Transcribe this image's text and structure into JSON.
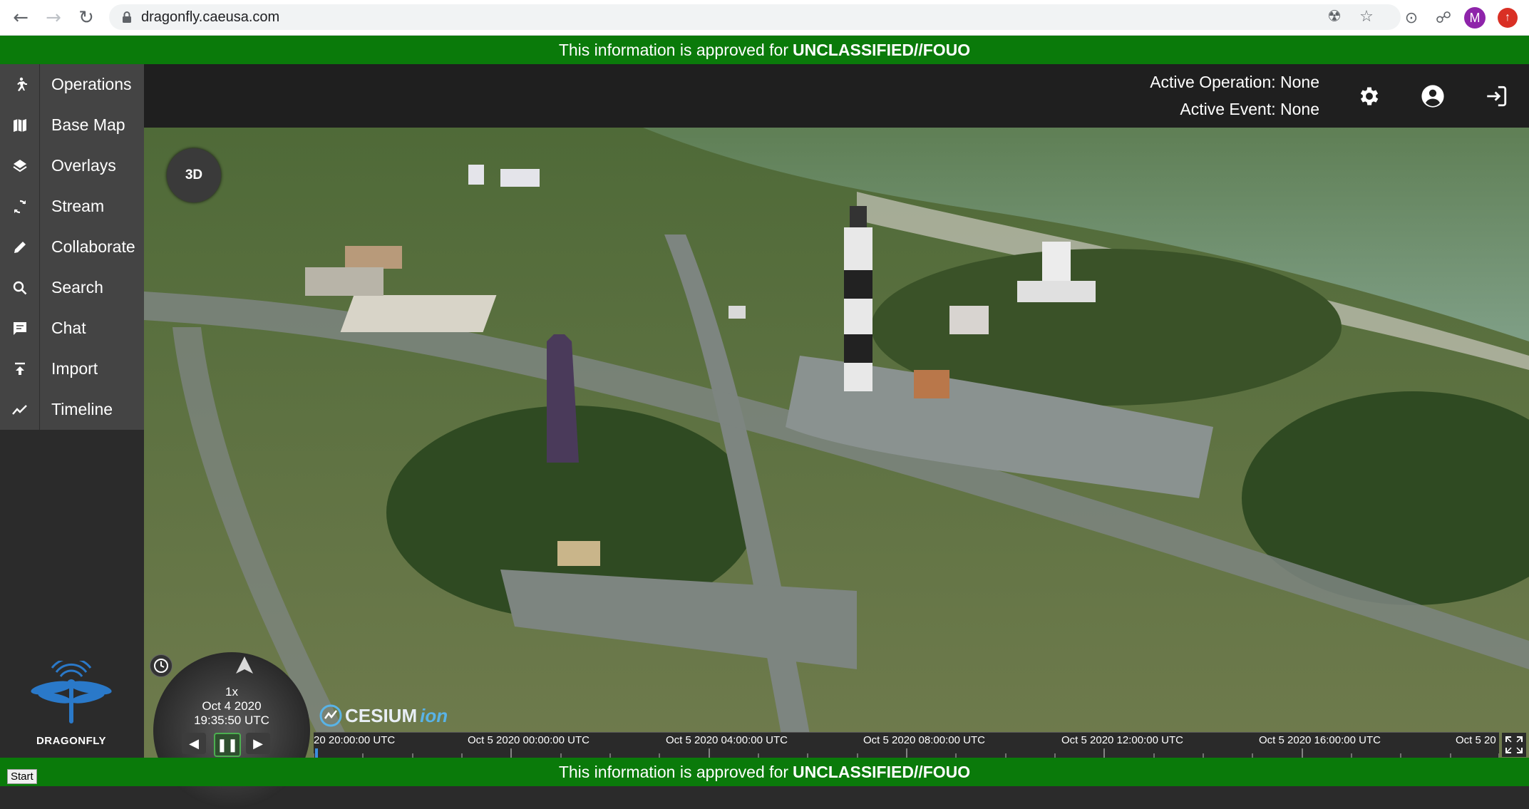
{
  "browser": {
    "url": "dragonfly.caeusa.com",
    "avatar_letter": "M"
  },
  "banner": {
    "prefix": "This information is approved for",
    "classification": "UNCLASSIFIED//FOUO"
  },
  "header": {
    "active_operation": "Active Operation: None",
    "active_event": "Active Event: None"
  },
  "sidebar": {
    "items": [
      {
        "label": "Operations",
        "icon": "running-person-icon"
      },
      {
        "label": "Base Map",
        "icon": "map-icon"
      },
      {
        "label": "Overlays",
        "icon": "layers-icon"
      },
      {
        "label": "Stream",
        "icon": "sync-icon"
      },
      {
        "label": "Collaborate",
        "icon": "pencil-icon"
      },
      {
        "label": "Search",
        "icon": "search-icon"
      },
      {
        "label": "Chat",
        "icon": "chat-icon"
      },
      {
        "label": "Import",
        "icon": "upload-icon"
      },
      {
        "label": "Timeline",
        "icon": "trend-line-icon"
      }
    ],
    "logo_text": "DRAGONFLY"
  },
  "map": {
    "mode_button": "3D",
    "attribution": "CESIUM",
    "attribution_suffix": "ion"
  },
  "animation": {
    "speed": "1x",
    "date": "Oct 4 2020",
    "time": "19:35:50 UTC"
  },
  "timeline": {
    "labels": [
      "20 20:00:00 UTC",
      "Oct 5 2020 00:00:00 UTC",
      "Oct 5 2020 04:00:00 UTC",
      "Oct 5 2020 08:00:00 UTC",
      "Oct 5 2020 12:00:00 UTC",
      "Oct 5 2020 16:00:00 UTC",
      "Oct 5 20"
    ]
  },
  "taskbar": {
    "start_label": "Start"
  },
  "colors": {
    "banner_green": "#0a7a0a",
    "sidebar_item": "#444444",
    "header_bg": "#1f1f1f"
  }
}
